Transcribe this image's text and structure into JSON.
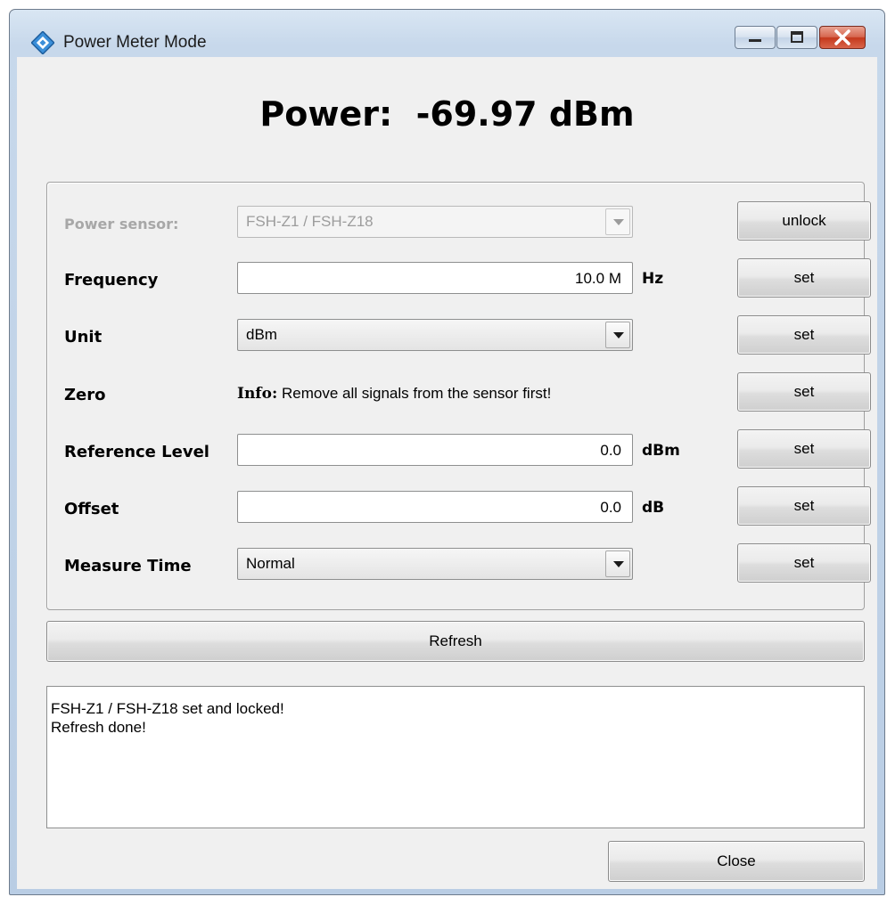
{
  "window": {
    "title": "Power Meter Mode",
    "icon": "app-diamond-icon"
  },
  "readout": {
    "text": "Power:  -69.97 dBm"
  },
  "settings": {
    "power_sensor": {
      "label": "Power sensor:",
      "value": "FSH-Z1 / FSH-Z18",
      "button": "unlock"
    },
    "frequency": {
      "label": "Frequency",
      "value": "10.0 M",
      "unit": "Hz",
      "button": "set"
    },
    "unit": {
      "label": "Unit",
      "value": "dBm",
      "button": "set"
    },
    "zero": {
      "label": "Zero",
      "info_prefix": "Info:",
      "info_text": " Remove all signals from the sensor first!",
      "button": "set"
    },
    "reference_level": {
      "label": "Reference Level",
      "value": "0.0",
      "unit": "dBm",
      "button": "set"
    },
    "offset": {
      "label": "Offset",
      "value": "0.0",
      "unit": "dB",
      "button": "set"
    },
    "measure_time": {
      "label": "Measure Time",
      "value": "Normal",
      "button": "set"
    }
  },
  "refresh_label": "Refresh",
  "log": {
    "lines": [
      "FSH-Z1 / FSH-Z18 set and locked!",
      "Refresh done!"
    ]
  },
  "close_label": "Close",
  "colors": {
    "title_bar": "#c7d8eb",
    "close_button": "#c4381c",
    "dialog_bg": "#f0f0f0"
  }
}
